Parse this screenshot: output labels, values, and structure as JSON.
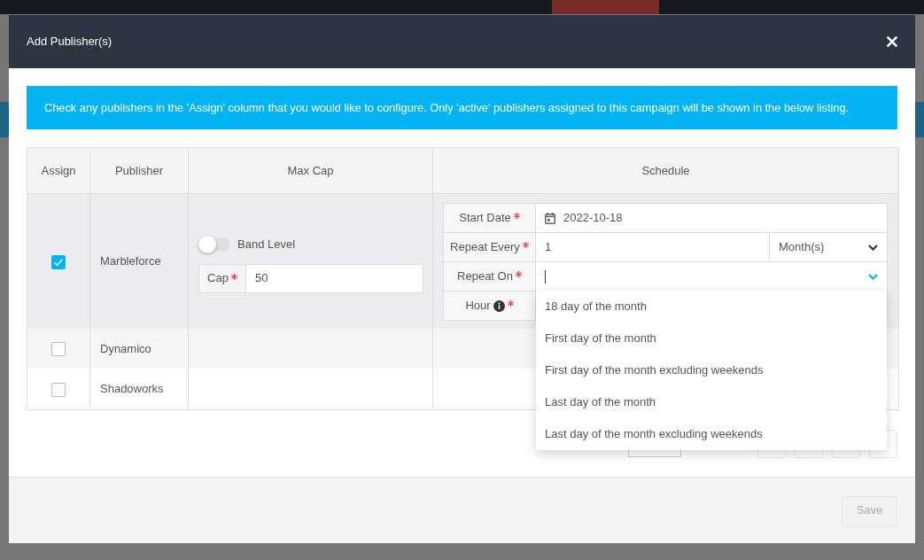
{
  "dialog": {
    "title": "Add Publisher(s)"
  },
  "alert": {
    "text": "Check any publishers in the 'Assign' column that you would like to configure. Only 'active' publishers assigned to this campaign will be shown in the below listing."
  },
  "table": {
    "columns": [
      "Assign",
      "Publisher",
      "Max Cap",
      "Schedule"
    ],
    "rows": [
      {
        "publisher": "Marbleforce",
        "checked": true,
        "max_cap": {
          "band_level": {
            "label": "Band Level",
            "on": false
          },
          "cap": {
            "label": "Cap",
            "required": true,
            "value": "50"
          }
        },
        "schedule": [
          {
            "kind": "date",
            "label": "Start Date",
            "required": true,
            "value": "2022-10-18"
          },
          {
            "kind": "repeat",
            "label": "Repeat Every",
            "required": true,
            "value": "1",
            "unit": "Month(s)"
          },
          {
            "kind": "combo",
            "label": "Repeat On",
            "required": true,
            "expanded": true,
            "options": [
              {
                "label": "18 day of the month",
                "selected": false
              },
              {
                "label": "First day of the month",
                "selected": false
              },
              {
                "label": "First day of the month excluding weekends",
                "selected": false
              },
              {
                "label": "Last day of the month",
                "selected": false
              },
              {
                "label": "Last day of the month excluding weekends",
                "selected": false
              }
            ]
          },
          {
            "kind": "hour",
            "label": "Hour",
            "required": true,
            "info": true
          }
        ]
      },
      {
        "publisher": "Dynamico",
        "checked": false
      },
      {
        "publisher": "Shadoworks",
        "checked": false
      }
    ]
  },
  "footer": {
    "save": {
      "label": "Save",
      "disabled": true
    }
  }
}
